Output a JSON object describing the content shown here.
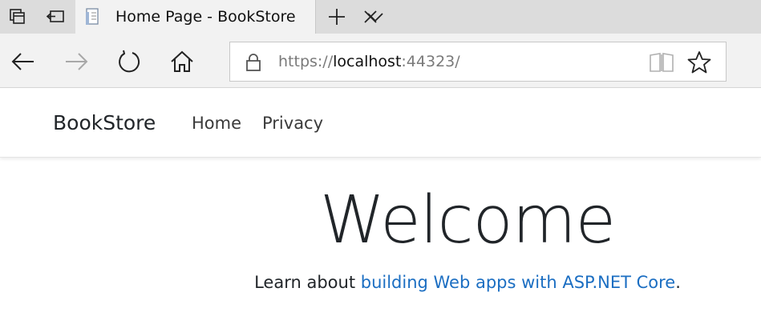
{
  "browser": {
    "tab": {
      "title": "Home Page - BookStore"
    },
    "address": {
      "scheme": "https://",
      "host": "localhost",
      "port": ":44323/"
    },
    "colors": {
      "tabstrip_bg": "#dcdcdc",
      "active_tab_bg": "#f2f2f2",
      "address_text_dim": "#7a7a7a"
    },
    "icons": {
      "tab_actions": "tab-actions-icon",
      "tabs_aside": "set-tabs-aside-icon",
      "favicon": "page-favicon-icon",
      "close_tab": "close-icon",
      "new_tab": "plus-icon",
      "tab_preview": "chevron-down-icon",
      "back": "back-arrow-icon",
      "forward": "forward-arrow-icon",
      "refresh": "refresh-icon",
      "home": "home-icon",
      "lock": "lock-icon",
      "reading_view": "reading-view-icon",
      "favorite": "star-icon"
    }
  },
  "site": {
    "brand": "BookStore",
    "nav": [
      {
        "label": "Home"
      },
      {
        "label": "Privacy"
      }
    ],
    "main": {
      "heading": "Welcome",
      "learn_prefix": "Learn about ",
      "learn_link": "building Web apps with ASP.NET Core",
      "learn_suffix": "."
    },
    "colors": {
      "link": "#1b6ec2",
      "text": "#212529"
    }
  }
}
